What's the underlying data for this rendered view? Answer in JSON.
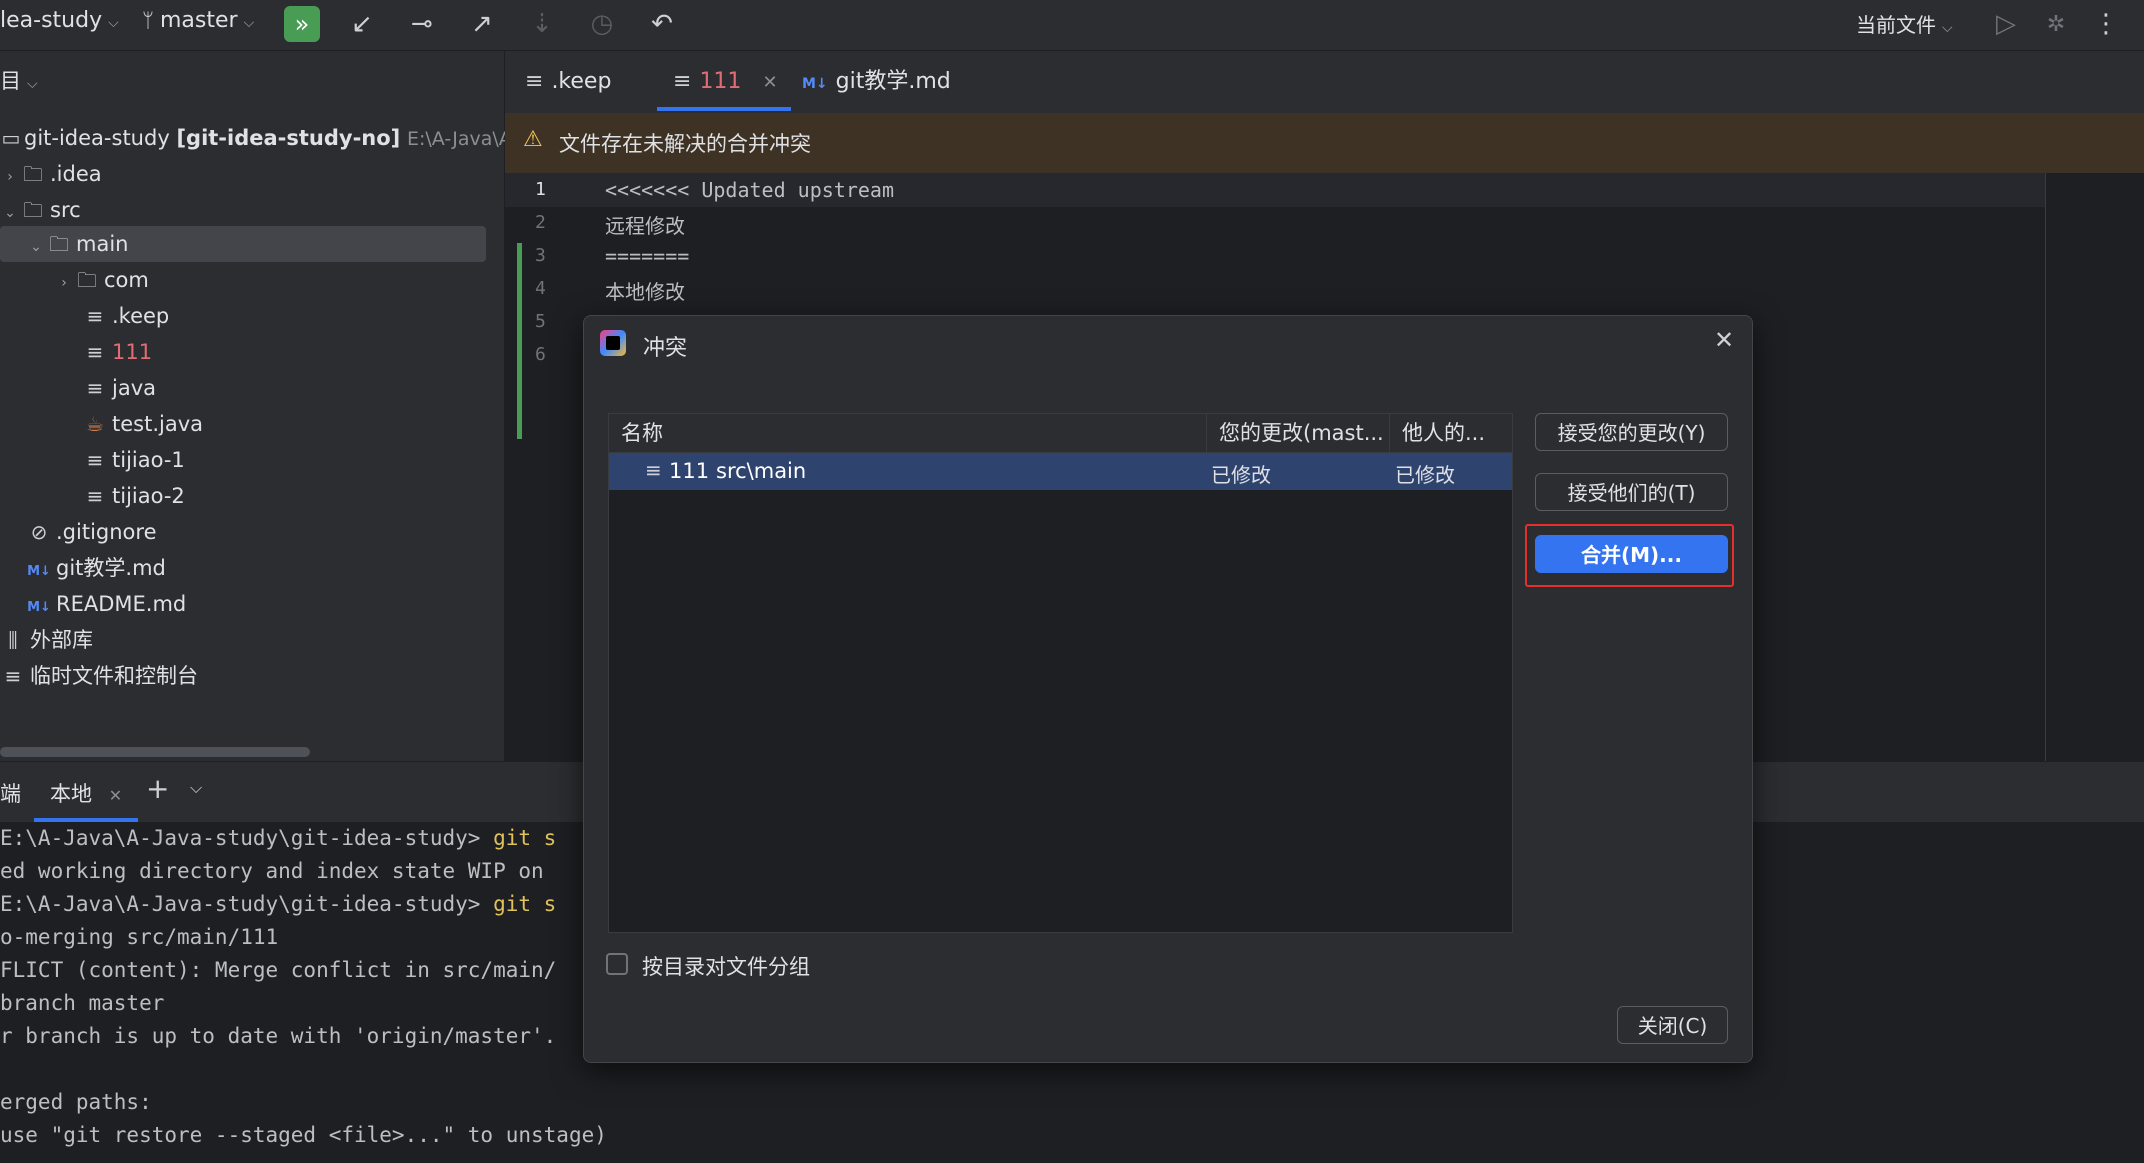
{
  "toolbar": {
    "project_name": "lea-study",
    "branch": "master",
    "run_config": "当前文件",
    "colors": {
      "accent_green": "#499c54"
    }
  },
  "project_panel": {
    "header": "目",
    "items": [
      {
        "label": "git-idea-study",
        "bold_suffix": "[git-idea-study-no]",
        "path_hint": "E:\\A-Java\\A",
        "icon": "module-icon"
      },
      {
        "label": ".idea",
        "icon": "folder-icon"
      },
      {
        "label": "src",
        "icon": "folder-icon"
      },
      {
        "label": "main",
        "icon": "folder-icon"
      },
      {
        "label": "com",
        "icon": "folder-icon"
      },
      {
        "label": ".keep",
        "icon": "text-file-icon"
      },
      {
        "label": "111",
        "icon": "text-file-icon",
        "color": "#e06c75"
      },
      {
        "label": "java",
        "icon": "text-file-icon"
      },
      {
        "label": "test.java",
        "icon": "java-file-icon"
      },
      {
        "label": "tijiao-1",
        "icon": "text-file-icon"
      },
      {
        "label": "tijiao-2",
        "icon": "text-file-icon"
      },
      {
        "label": ".gitignore",
        "icon": "ignore-file-icon"
      },
      {
        "label": "git教学.md",
        "icon": "markdown-icon"
      },
      {
        "label": "README.md",
        "icon": "markdown-icon"
      },
      {
        "label": "外部库",
        "icon": "library-icon"
      },
      {
        "label": "临时文件和控制台",
        "icon": "scratch-icon"
      }
    ]
  },
  "editor": {
    "tabs": [
      {
        "label": ".keep"
      },
      {
        "label": "111",
        "active": true
      },
      {
        "label": "git教学.md"
      }
    ],
    "warning": "文件存在未解决的合并冲突",
    "lines": [
      {
        "no": "1",
        "text": "<<<<<<< Updated upstream"
      },
      {
        "no": "2",
        "text": "远程修改"
      },
      {
        "no": "3",
        "text": "======="
      },
      {
        "no": "4",
        "text": "本地修改"
      },
      {
        "no": "5",
        "text": ""
      },
      {
        "no": "6",
        "text": ""
      }
    ]
  },
  "terminal": {
    "tab_prefix": "端",
    "tab_label": "本地",
    "lines": [
      {
        "text": "E:\\A-Java\\A-Java-study\\git-idea-study> ",
        "cmd": "git s"
      },
      {
        "text": "ed working directory and index state WIP on"
      },
      {
        "text": "E:\\A-Java\\A-Java-study\\git-idea-study> ",
        "cmd": "git s"
      },
      {
        "text": "o-merging src/main/111"
      },
      {
        "text": "FLICT (content): Merge conflict in src/main/"
      },
      {
        "text": "branch master"
      },
      {
        "text": "r branch is up to date with 'origin/master'."
      },
      {
        "text": ""
      },
      {
        "text": "erged paths:"
      },
      {
        "text": "use \"git restore --staged <file>...\" to unstage)"
      }
    ]
  },
  "dialog": {
    "title": "冲突",
    "columns": [
      "名称",
      "您的更改(mast...",
      "他人的..."
    ],
    "rows": [
      {
        "name": "111",
        "path": "src\\main",
        "yours": "已修改",
        "theirs": "已修改"
      }
    ],
    "buttons": {
      "accept_yours": "接受您的更改(Y)",
      "accept_theirs": "接受他们的(T)",
      "merge": "合并(M)...",
      "close": "关闭(C)"
    },
    "group_checkbox_label": "按目录对文件分组",
    "colors": {
      "highlight_border": "#e5302a",
      "primary": "#3574f0",
      "selected_row": "#2e436e"
    }
  }
}
